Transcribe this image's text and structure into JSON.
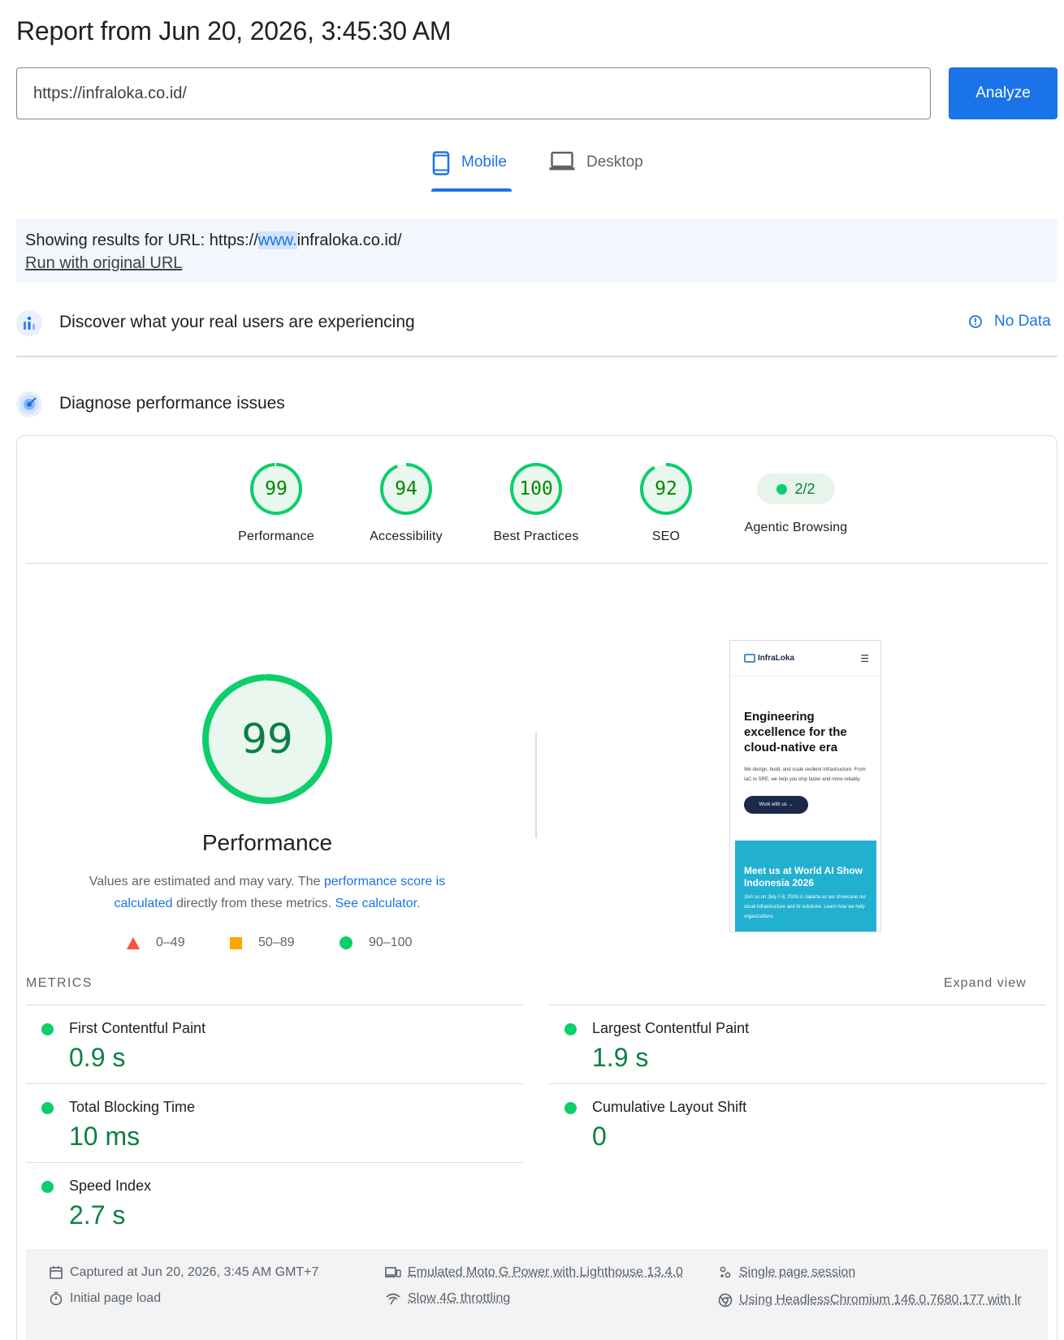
{
  "header": {
    "title": "Report from Jun 20, 2026, 3:45:30 AM",
    "url_value": "https://infraloka.co.id/",
    "analyze_label": "Analyze"
  },
  "tabs": {
    "mobile": "Mobile",
    "desktop": "Desktop",
    "active": "Mobile"
  },
  "banner": {
    "prefix": "Showing results for URL: https://",
    "highlight": "www.",
    "suffix": "infraloka.co.id/",
    "run_link": "Run with original URL"
  },
  "field_data": {
    "title": "Discover what your real users are experiencing",
    "status": "No Data"
  },
  "lab_data": {
    "title": "Diagnose performance issues"
  },
  "scores": [
    {
      "label": "Performance",
      "value": "99",
      "fraction": 0.99
    },
    {
      "label": "Accessibility",
      "value": "94",
      "fraction": 0.94
    },
    {
      "label": "Best Practices",
      "value": "100",
      "fraction": 1.0
    },
    {
      "label": "SEO",
      "value": "92",
      "fraction": 0.92
    }
  ],
  "agentic": {
    "label": "Agentic Browsing",
    "value": "2/2"
  },
  "performance": {
    "score": "99",
    "fraction": 0.99,
    "title": "Performance",
    "desc_1": "Values are estimated and may vary. The ",
    "link_1": "performance score is calculated",
    "desc_2": " directly from these metrics. ",
    "link_2": "See calculator",
    "desc_3": "."
  },
  "legend": {
    "fail": "0–49",
    "average": "50–89",
    "pass": "90–100"
  },
  "colors": {
    "pass": "#0cce6b",
    "average": "#ffa400",
    "fail": "#ff4e42",
    "accent": "#1a73e8"
  },
  "screenshot": {
    "brand": "InfraLoka",
    "headline": "Engineering excellence for the cloud-native era",
    "body": "We design, build, and scale resilient infrastructure. From IaC to SRE, we help you ship faster and more reliably.",
    "cta": "Work with us →",
    "promo_title": "Meet us at World AI Show Indonesia 2026",
    "promo_text": "Join us on July 7-8, 2026 in Jakarta as we showcase our cloud infrastructure and AI solutions. Learn how we help organizations"
  },
  "metrics": {
    "header": "METRICS",
    "expand": "Expand view",
    "fcp": {
      "name": "First Contentful Paint",
      "value": "0.9 s"
    },
    "lcp": {
      "name": "Largest Contentful Paint",
      "value": "1.9 s"
    },
    "tbt": {
      "name": "Total Blocking Time",
      "value": "10 ms"
    },
    "cls": {
      "name": "Cumulative Layout Shift",
      "value": "0"
    },
    "si": {
      "name": "Speed Index",
      "value": "2.7 s"
    }
  },
  "runtime": {
    "captured": "Captured at Jun 20, 2026, 3:45 AM GMT+7",
    "load": "Initial page load",
    "device": "Emulated Moto G Power with Lighthouse 13.4.0",
    "throttling": "Slow 4G throttling",
    "session": "Single page session",
    "browser": "Using HeadlessChromium 146.0.7680.177 with lr"
  }
}
